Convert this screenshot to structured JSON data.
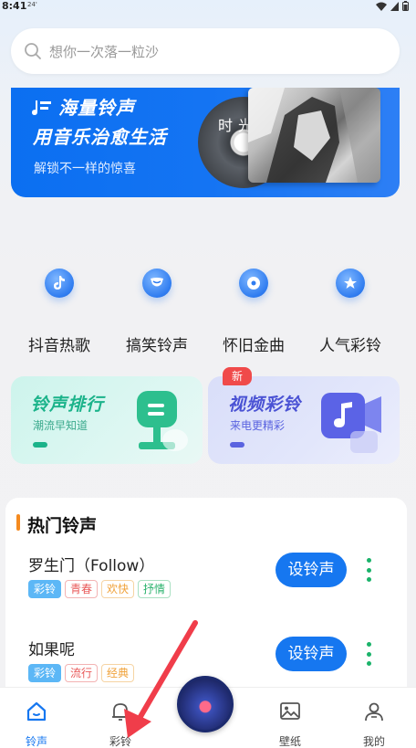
{
  "status_bar": {
    "time": "8:41",
    "extra": "24'"
  },
  "search": {
    "placeholder": "想你一次落一粒沙"
  },
  "banner": {
    "line1": "海量铃声",
    "line2": "用音乐治愈生活",
    "line3": "解锁不一样的惊喜",
    "cd_text": "时光"
  },
  "categories": [
    {
      "label": "抖音热歌",
      "icon": "tiktok-icon"
    },
    {
      "label": "搞笑铃声",
      "icon": "laugh-icon"
    },
    {
      "label": "怀旧金曲",
      "icon": "record-icon"
    },
    {
      "label": "人气彩铃",
      "icon": "star-medal-icon"
    }
  ],
  "cards": [
    {
      "title": "铃声排行",
      "subtitle": "潮流早知道",
      "accent": "#1bb38a"
    },
    {
      "title": "视频彩铃",
      "subtitle": "来电更精彩",
      "accent": "#5a63e0",
      "badge": "新"
    }
  ],
  "hot": {
    "title": "热门铃声",
    "songs": [
      {
        "name": "罗生门（Follow）",
        "tags": [
          "彩铃",
          "青春",
          "欢快",
          "抒情"
        ],
        "button": "设铃声"
      },
      {
        "name": "如果呢",
        "tags": [
          "彩铃",
          "流行",
          "经典"
        ],
        "button": "设铃声"
      }
    ]
  },
  "tag_colors": {
    "青春": "#e95a5a",
    "欢快": "#f0a23a",
    "抒情": "#2db36f",
    "流行": "#e95a5a",
    "经典": "#f0a23a"
  },
  "tabbar": [
    {
      "label": "铃声",
      "icon": "home-icon",
      "active": true
    },
    {
      "label": "彩铃",
      "icon": "bell-icon",
      "active": false
    },
    {
      "label": "壁纸",
      "icon": "image-icon",
      "active": false
    },
    {
      "label": "我的",
      "icon": "user-icon",
      "active": false
    }
  ],
  "colors": {
    "primary": "#1677f0",
    "banner": "#0b6ff1",
    "accent_orange": "#f58a1f"
  }
}
